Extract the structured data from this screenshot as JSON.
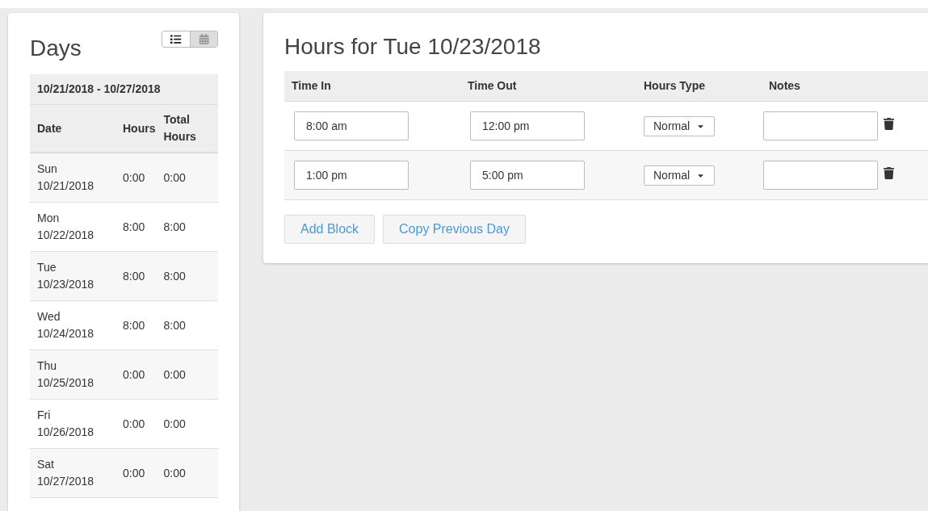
{
  "days_panel": {
    "title": "Days",
    "view_toggle": [
      {
        "kind": "list",
        "selected": true
      },
      {
        "kind": "calendar",
        "selected": false
      }
    ],
    "week_range": "10/21/2018 - 10/27/2018",
    "columns": [
      "Date",
      "Hours",
      "Total Hours"
    ],
    "rows": [
      {
        "weekday": "Sun",
        "date": "10/21/2018",
        "hours": "0:00",
        "total": "0:00"
      },
      {
        "weekday": "Mon",
        "date": "10/22/2018",
        "hours": "8:00",
        "total": "8:00"
      },
      {
        "weekday": "Tue",
        "date": "10/23/2018",
        "hours": "8:00",
        "total": "8:00"
      },
      {
        "weekday": "Wed",
        "date": "10/24/2018",
        "hours": "8:00",
        "total": "8:00"
      },
      {
        "weekday": "Thu",
        "date": "10/25/2018",
        "hours": "0:00",
        "total": "0:00"
      },
      {
        "weekday": "Fri",
        "date": "10/26/2018",
        "hours": "0:00",
        "total": "0:00"
      },
      {
        "weekday": "Sat",
        "date": "10/27/2018",
        "hours": "0:00",
        "total": "0:00"
      }
    ]
  },
  "hours_panel": {
    "title": "Hours for Tue 10/23/2018",
    "columns": [
      "Time In",
      "Time Out",
      "Hours Type",
      "Notes"
    ],
    "blocks": [
      {
        "time_in": "8:00 am",
        "time_out": "12:00 pm",
        "hours_type": "Normal"
      },
      {
        "time_in": "1:00 pm",
        "time_out": "5:00 pm",
        "hours_type": "Normal"
      }
    ],
    "buttons": [
      "Add Block",
      "Copy Previous Day"
    ]
  }
}
